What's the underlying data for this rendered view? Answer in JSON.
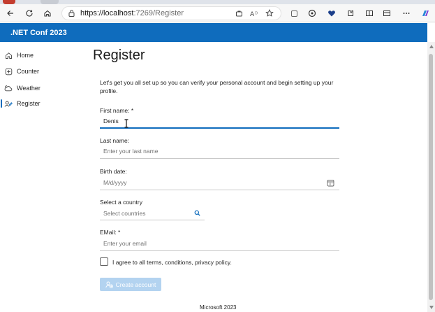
{
  "browser": {
    "url_host": "https://localhost",
    "url_rest": ":7269/Register"
  },
  "app": {
    "brand": ".NET Conf 2023"
  },
  "sidebar": {
    "items": [
      {
        "label": "Home",
        "icon": "home-icon"
      },
      {
        "label": "Counter",
        "icon": "plus-square-icon"
      },
      {
        "label": "Weather",
        "icon": "weather-icon"
      },
      {
        "label": "Register",
        "icon": "register-icon"
      }
    ],
    "active": "Register"
  },
  "main": {
    "title": "Register",
    "intro": "Let's get you all set up so you can verify your personal account and begin setting up your profile.",
    "first_name": {
      "label": "First name: *",
      "value": "Denis"
    },
    "last_name": {
      "label": "Last name:",
      "placeholder": "Enter your last name"
    },
    "birth_date": {
      "label": "Birth date:",
      "placeholder": "M/d/yyyy"
    },
    "country": {
      "label": "Select a country",
      "placeholder": "Select countries"
    },
    "email": {
      "label": "EMail: *",
      "placeholder": "Enter your email"
    },
    "agree_label": "I agree to all terms, conditions, privacy policy.",
    "create_button": "Create account"
  },
  "footer": {
    "text": "Microsoft 2023"
  },
  "colors": {
    "accent": "#0f6cbd",
    "button_disabled": "#b3d3f0"
  }
}
